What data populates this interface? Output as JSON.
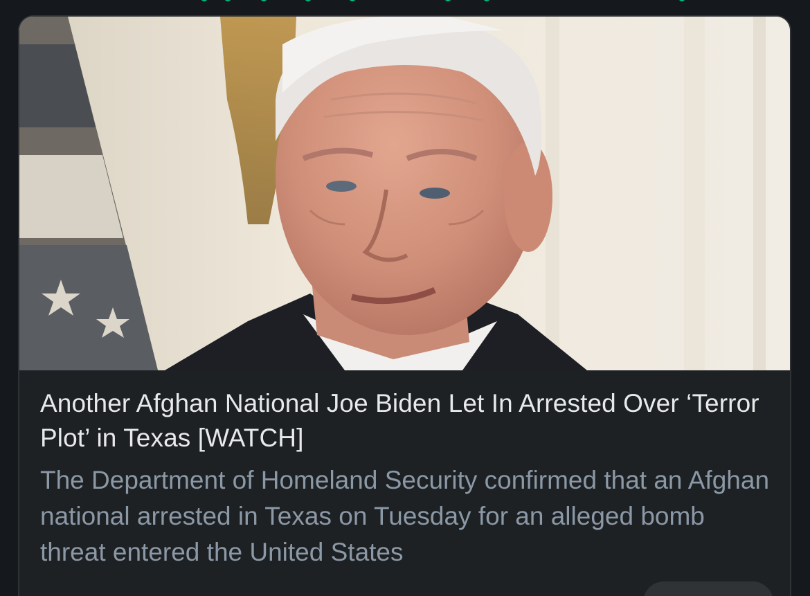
{
  "article": {
    "headline": "Another Afghan National Joe Biden Let In Arrested Over ‘Terror Plot’ in Texas [WATCH]",
    "description": "The Department of Homeland Security confirmed that an Afghan national arrested in Texas on Tuesday for an alleged bomb threat entered the United States"
  },
  "image": {
    "subject": "portrait-photo"
  },
  "colors": {
    "page_bg": "#15181c",
    "card_bg": "#1e2124",
    "card_border": "#2f3336",
    "headline_text": "#e7e9ea",
    "description_text": "#8b98a5",
    "accent_green": "#00ba7c"
  },
  "icons": {
    "source_link": "link-icon"
  }
}
